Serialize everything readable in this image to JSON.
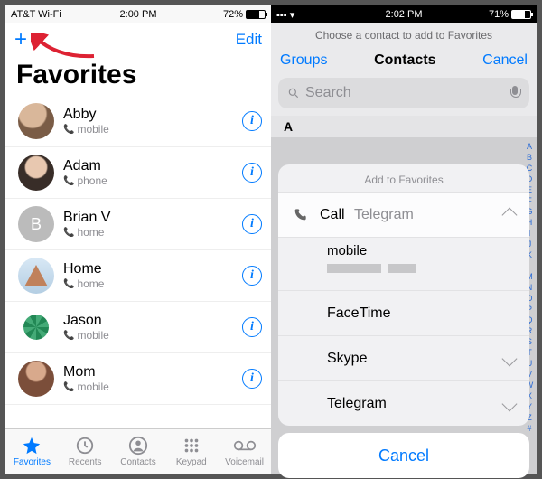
{
  "left": {
    "status": {
      "carrier": "AT&T Wi-Fi",
      "time": "2:00 PM",
      "battery_pct": "72%",
      "battery_fill": "72%"
    },
    "nav": {
      "add": "+",
      "edit": "Edit"
    },
    "title": "Favorites",
    "contacts": [
      {
        "name": "Abby",
        "type": "mobile",
        "avatar": "photo-a",
        "letter": ""
      },
      {
        "name": "Adam",
        "type": "phone",
        "avatar": "photo-b",
        "letter": ""
      },
      {
        "name": "Brian V",
        "type": "home",
        "avatar": "letter",
        "letter": "B"
      },
      {
        "name": "Home",
        "type": "home",
        "avatar": "photo-h",
        "letter": ""
      },
      {
        "name": "Jason",
        "type": "mobile",
        "avatar": "photo-j",
        "letter": ""
      },
      {
        "name": "Mom",
        "type": "mobile",
        "avatar": "photo-m",
        "letter": ""
      }
    ],
    "tabs": {
      "favorites": "Favorites",
      "recents": "Recents",
      "contacts": "Contacts",
      "keypad": "Keypad",
      "voicemail": "Voicemail"
    }
  },
  "right": {
    "status": {
      "time": "2:02 PM",
      "battery_pct": "71%",
      "battery_fill": "71%"
    },
    "header_prompt": "Choose a contact to add to Favorites",
    "toolbar": {
      "groups": "Groups",
      "title": "Contacts",
      "cancel": "Cancel"
    },
    "search": {
      "placeholder": "Search"
    },
    "index_letter": "A",
    "sheet": {
      "title": "Add to Favorites",
      "row_call": {
        "label": "Call",
        "secondary": "Telegram"
      },
      "row_mobile_label": "mobile",
      "row_facetime": "FaceTime",
      "row_skype": "Skype",
      "row_telegram": "Telegram",
      "cancel": "Cancel"
    }
  }
}
